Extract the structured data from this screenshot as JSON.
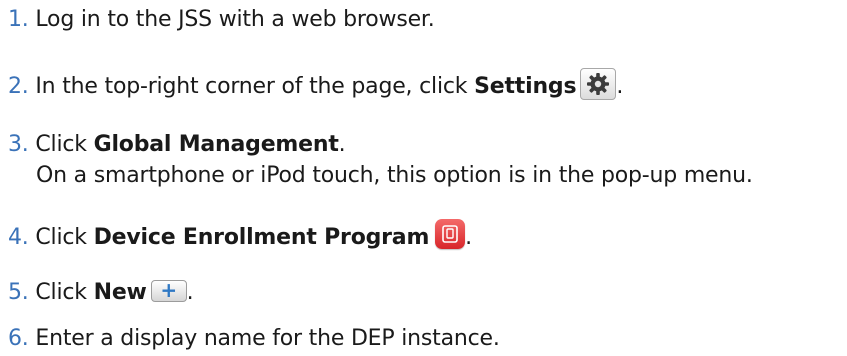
{
  "steps": [
    {
      "num": "1.",
      "parts": [
        "Log in to the JSS with a web browser."
      ]
    },
    {
      "num": "2.",
      "parts": [
        "In the top-right corner of the page, click ",
        "Settings",
        "."
      ],
      "icon": "gear-icon"
    },
    {
      "num": "3.",
      "parts": [
        "Click ",
        "Global Management",
        "."
      ],
      "note": "On a smartphone or iPod touch, this option is in the pop-up menu."
    },
    {
      "num": "4.",
      "parts": [
        "Click ",
        "Device Enrollment Program",
        "."
      ],
      "icon": "device-enrollment-icon"
    },
    {
      "num": "5.",
      "parts": [
        "Click ",
        "New",
        "."
      ],
      "icon": "plus-icon",
      "icon_label": "+"
    },
    {
      "num": "6.",
      "parts": [
        "Enter a display name for the DEP instance."
      ]
    }
  ],
  "colors": {
    "number": "#3a72b8",
    "text": "#1a1a1a",
    "dep_icon": "#e23a3c",
    "plus": "#2f78c4"
  }
}
